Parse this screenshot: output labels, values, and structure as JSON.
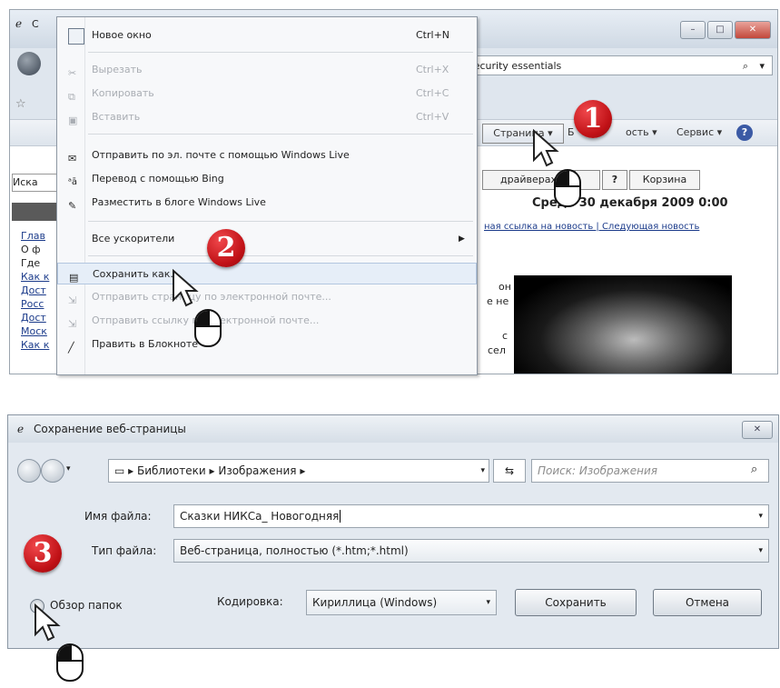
{
  "browser": {
    "title_fragment": "С",
    "address_text": "security essentials",
    "command_bar": {
      "page_label": "Страница ▾",
      "safety_fragment": "Б",
      "safety_tail": "ость ▾",
      "tools_label": "Сервис ▾",
      "help_label": "?"
    },
    "page": {
      "toolbar_items": [
        "драйверах",
        "?",
        "Корзина"
      ],
      "date_text": "Сред   30 декабря 2009 0:00",
      "left_search": "Иска",
      "left_links": [
        "Глав",
        "О ф",
        "Где",
        "Как к",
        "Дост",
        "Росс",
        "Дост",
        "Моск",
        "Как к"
      ],
      "news_links": "ная ссылка на новость | Следующая новость",
      "text_frag1": "он",
      "text_frag2": "е не",
      "text_frag3": "с",
      "text_frag4": "сел"
    }
  },
  "menu": {
    "items": [
      {
        "label": "Новое окно",
        "shortcut": "Ctrl+N",
        "disabled": false
      },
      {
        "label": "Вырезать",
        "shortcut": "Ctrl+X",
        "disabled": true
      },
      {
        "label": "Копировать",
        "shortcut": "Ctrl+C",
        "disabled": true
      },
      {
        "label": "Вставить",
        "shortcut": "Ctrl+V",
        "disabled": true
      },
      {
        "label": "Отправить по эл. почте с помощью Windows Live",
        "shortcut": "",
        "disabled": false
      },
      {
        "label": "Перевод с помощью Bing",
        "shortcut": "",
        "disabled": false
      },
      {
        "label": "Разместить в блоге Windows Live",
        "shortcut": "",
        "disabled": false
      },
      {
        "label": "Все ускорители",
        "shortcut": "▶",
        "disabled": false
      },
      {
        "label": "Сохранить как...",
        "shortcut": "",
        "disabled": false
      },
      {
        "label": "Отправить страницу по электронной почте...",
        "shortcut": "",
        "disabled": true
      },
      {
        "label": "Отправить ссылку по электронной почте...",
        "shortcut": "",
        "disabled": true
      },
      {
        "label": "Править в Блокноте",
        "shortcut": "",
        "disabled": false
      }
    ]
  },
  "badges": {
    "one": "1",
    "two": "2",
    "three": "3"
  },
  "dialog": {
    "title": "Сохранение веб-страницы",
    "breadcrumb": [
      "Библиотеки",
      "Изображения"
    ],
    "search_placeholder": "Поиск: Изображения",
    "filename_label": "Имя файла:",
    "filename_value": "Сказки НИКСа_ Новогодняя",
    "filetype_label": "Тип файла:",
    "filetype_value": "Веб-страница, полностью (*.htm;*.html)",
    "browse_label": "Обзор папок",
    "encoding_label": "Кодировка:",
    "encoding_value": "Кириллица (Windows)",
    "save_button": "Сохранить",
    "cancel_button": "Отмена"
  },
  "colors": {
    "badge": "#c01116",
    "accent": "#1a3a8a"
  }
}
